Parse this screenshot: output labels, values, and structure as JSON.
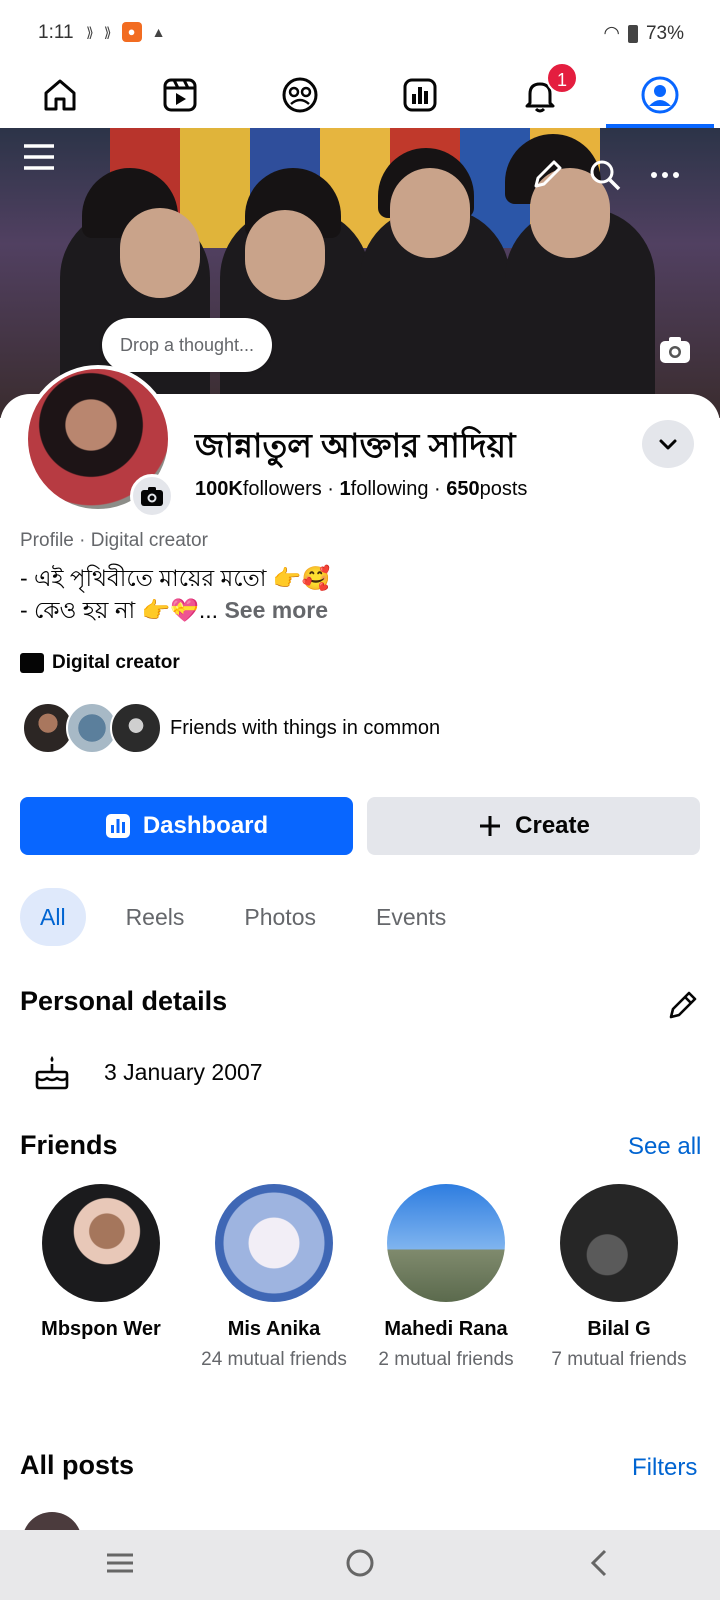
{
  "status": {
    "time": "1:11",
    "battery": "73%"
  },
  "nav": {
    "tabs": [
      "home",
      "reels",
      "groups",
      "dashboard",
      "notifications",
      "profile"
    ],
    "notification_count": "1",
    "active": "profile"
  },
  "cover": {
    "thought_placeholder": "Drop a thought..."
  },
  "profile": {
    "name": "জান্নাতুল আক্তার সাদিয়া",
    "followers_count": "100K",
    "followers_label": "followers",
    "following_count": "1",
    "following_label": "following",
    "posts_count": "650",
    "posts_label": "posts",
    "category_line": "Profile · Digital creator",
    "bio_line1": "- এই পৃথিবীতে মায়ের মতো 👉🥰",
    "bio_line2": "- কেও হয় না 👉💝...",
    "see_more": "See more",
    "creator_label": "Digital creator",
    "friends_common": "Friends with things in common"
  },
  "actions": {
    "dashboard_label": "Dashboard",
    "create_label": "Create"
  },
  "filters": [
    "All",
    "Reels",
    "Photos",
    "Events"
  ],
  "personal_details": {
    "title": "Personal details",
    "birthday": "3 January 2007"
  },
  "friends": {
    "title": "Friends",
    "see_all": "See all",
    "items": [
      {
        "name": "Mbspon Wer",
        "mutual": ""
      },
      {
        "name": "Mis Anika",
        "mutual": "24 mutual friends"
      },
      {
        "name": "Mahedi Rana",
        "mutual": "2 mutual friends"
      },
      {
        "name": "Bilal G",
        "mutual": "7 mutual friends"
      }
    ]
  },
  "posts": {
    "title": "All posts",
    "filters_link": "Filters"
  },
  "colors": {
    "accent": "#0866ff",
    "link": "#0064d1",
    "badge": "#e41e3f"
  }
}
